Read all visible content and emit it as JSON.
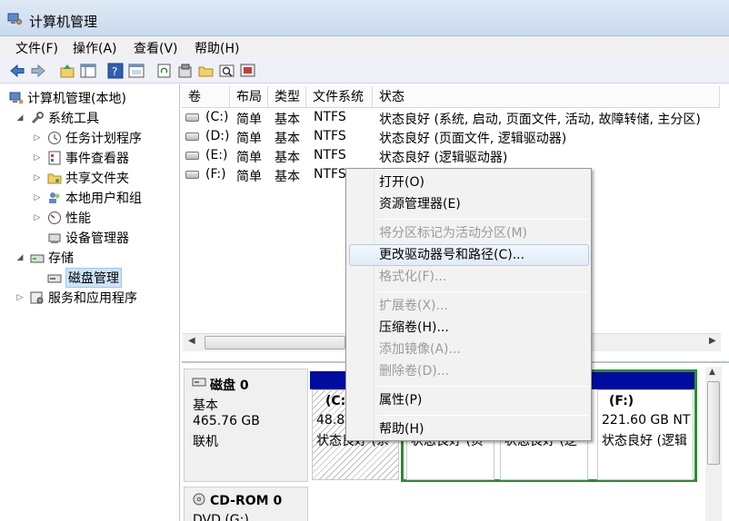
{
  "window": {
    "title": "计算机管理"
  },
  "menu": [
    "文件(F)",
    "操作(A)",
    "查看(V)",
    "帮助(H)"
  ],
  "toolbar_icons": [
    "back-icon",
    "forward-icon",
    "up-icon",
    "show-hide-tree-icon",
    "help-icon",
    "properties-icon",
    "refresh-icon",
    "settings-icon",
    "open-folder-icon",
    "find-icon",
    "console-icon"
  ],
  "tree": {
    "root": "计算机管理(本地)",
    "system_tools": "系统工具",
    "task_scheduler": "任务计划程序",
    "event_viewer": "事件查看器",
    "shared_folders": "共享文件夹",
    "local_users": "本地用户和组",
    "performance": "性能",
    "device_manager": "设备管理器",
    "storage": "存储",
    "disk_management": "磁盘管理",
    "services": "服务和应用程序"
  },
  "volumes": {
    "headers": [
      "卷",
      "布局",
      "类型",
      "文件系统",
      "状态"
    ],
    "rows": [
      {
        "vol": "(C:)",
        "layout": "简单",
        "type": "基本",
        "fs": "NTFS",
        "status": "状态良好 (系统, 启动, 页面文件, 活动, 故障转储, 主分区)"
      },
      {
        "vol": "(D:)",
        "layout": "简单",
        "type": "基本",
        "fs": "NTFS",
        "status": "状态良好 (页面文件, 逻辑驱动器)"
      },
      {
        "vol": "(E:)",
        "layout": "简单",
        "type": "基本",
        "fs": "NTFS",
        "status": "状态良好 (逻辑驱动器)"
      },
      {
        "vol": "(F:)",
        "layout": "简单",
        "type": "基本",
        "fs": "NTFS",
        "status": ""
      }
    ]
  },
  "disk0": {
    "name": "磁盘 0",
    "kind": "基本",
    "size": "465.76 GB",
    "state": "联机",
    "parts": {
      "c": {
        "label": "(C:)",
        "size": "48.8",
        "status": "状态良好 (系"
      },
      "d": {
        "status": "状态良好 (页"
      },
      "e": {
        "status": "状态良好 (逻"
      },
      "f": {
        "label": "(F:)",
        "size": "221.60 GB NT",
        "status": "状态良好 (逻辑"
      }
    }
  },
  "cdrom": {
    "name": "CD-ROM 0",
    "sub": "DVD (G:)"
  },
  "context_menu": {
    "open": "打开(O)",
    "explorer": "资源管理器(E)",
    "mark_active": "将分区标记为活动分区(M)",
    "change_letter": "更改驱动器号和路径(C)...",
    "format": "格式化(F)...",
    "extend": "扩展卷(X)...",
    "shrink": "压缩卷(H)...",
    "add_mirror": "添加镜像(A)...",
    "delete": "删除卷(D)...",
    "properties": "属性(P)",
    "help": "帮助(H)"
  },
  "colors": {
    "partition_header": "#000c9e",
    "selected_outline": "#2e8b2e",
    "hatch": "#bdbdbd"
  }
}
